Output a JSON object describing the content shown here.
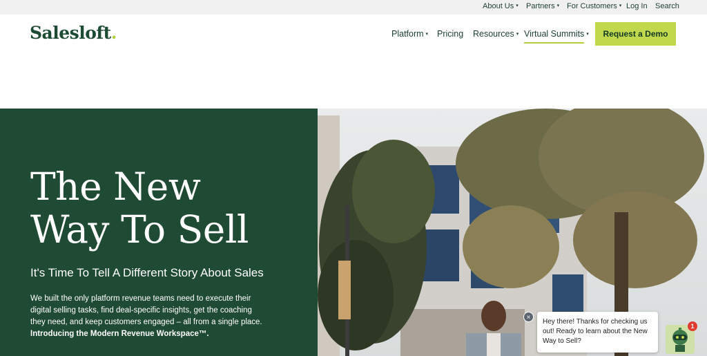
{
  "utility_nav": {
    "items": [
      {
        "label": "About Us",
        "dropdown": true
      },
      {
        "label": "Partners",
        "dropdown": true
      },
      {
        "label": "For Customers",
        "dropdown": true
      },
      {
        "label": "Log In",
        "dropdown": false
      },
      {
        "label": "Search",
        "dropdown": false
      }
    ]
  },
  "header": {
    "logo_text": "Salesloft",
    "logo_dot": ".",
    "nav": [
      {
        "label": "Platform",
        "dropdown": true
      },
      {
        "label": "Pricing",
        "dropdown": false
      },
      {
        "label": "Resources",
        "dropdown": true
      },
      {
        "label": "Virtual Summits",
        "dropdown": true,
        "active": true
      }
    ],
    "cta_label": "Request a Demo",
    "caret": "▾"
  },
  "hero": {
    "title_line1": "The New",
    "title_line2": "Way To Sell",
    "subtitle": "It's Time To Tell A Different Story About Sales",
    "body": "We built the only platform revenue teams need to execute their digital selling tasks, find deal-specific insights, get the coaching they need, and keep customers engaged – all from a single place.",
    "body_bold": "Introducing the Modern Revenue Workspace™."
  },
  "chat": {
    "close_glyph": "×",
    "message": "Hey there! Thanks for checking us out! Ready to learn about the New Way to Sell?",
    "badge_count": "1"
  },
  "colors": {
    "brand_green": "#1f4a34",
    "accent_lime": "#c1d84c",
    "utility_bg": "#f1f1f1"
  },
  "icons": {
    "dropdown": "chevron-down-icon",
    "chat_close": "close-icon",
    "chat_bot": "robot-icon"
  }
}
